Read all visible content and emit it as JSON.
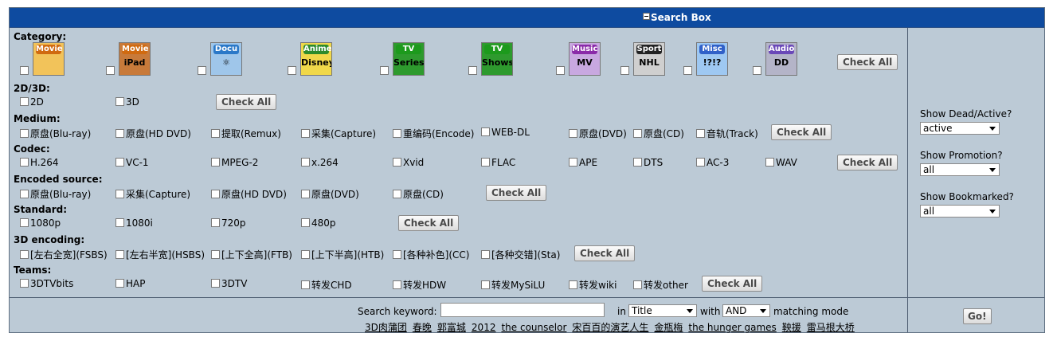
{
  "header": {
    "title": "Search Box"
  },
  "category": {
    "label": "Category:",
    "items": [
      {
        "name": "movie-bluray",
        "tag": "Movie",
        "sub": "",
        "color": "#d06a10",
        "bg": "#f2c35a"
      },
      {
        "name": "movie-ipad",
        "tag": "Movie",
        "sub": "iPad",
        "color": "#d06a10",
        "bg": "#c87a3a"
      },
      {
        "name": "docu",
        "tag": "Docu",
        "sub": "⚛",
        "color": "#2a78c8",
        "bg": "#9fc6ea"
      },
      {
        "name": "anime",
        "tag": "Anime",
        "sub": "Disney",
        "color": "#2c8a2c",
        "bg": "#f0d84a"
      },
      {
        "name": "tv-series",
        "tag": "TV",
        "sub": "Series",
        "color": "#1c9a1c",
        "bg": "#2e9a2e"
      },
      {
        "name": "tv-shows",
        "tag": "TV",
        "sub": "Shows",
        "color": "#1c9a1c",
        "bg": "#2e9a2e"
      },
      {
        "name": "music",
        "tag": "Music",
        "sub": "MV",
        "color": "#8a2aa8",
        "bg": "#c8a8e0"
      },
      {
        "name": "sport",
        "tag": "Sport",
        "sub": "NHL",
        "color": "#222222",
        "bg": "#cfcfcf"
      },
      {
        "name": "misc",
        "tag": "Misc",
        "sub": "!?!?",
        "color": "#3060c8",
        "bg": "#9ec8f2"
      },
      {
        "name": "audio",
        "tag": "Audio",
        "sub": "DD",
        "color": "#6a48b8",
        "bg": "#b4b4c8"
      }
    ],
    "check_all": "Check All"
  },
  "dim": {
    "label": "2D/3D:",
    "options": [
      "2D",
      "3D"
    ],
    "check_all": "Check All"
  },
  "medium": {
    "label": "Medium:",
    "options": [
      "原盘(Blu-ray)",
      "原盘(HD DVD)",
      "提取(Remux)",
      "采集(Capture)",
      "重编码(Encode)",
      "WEB-DL",
      "原盘(DVD)",
      "原盘(CD)",
      "音轨(Track)"
    ],
    "check_all": "Check All"
  },
  "codec": {
    "label": "Codec:",
    "options": [
      "H.264",
      "VC-1",
      "MPEG-2",
      "x.264",
      "Xvid",
      "FLAC",
      "APE",
      "DTS",
      "AC-3",
      "WAV"
    ],
    "check_all": "Check All"
  },
  "encoded": {
    "label": "Encoded source:",
    "options": [
      "原盘(Blu-ray)",
      "采集(Capture)",
      "原盘(HD DVD)",
      "原盘(DVD)",
      "原盘(CD)"
    ],
    "check_all": "Check All"
  },
  "standard": {
    "label": "Standard:",
    "options": [
      "1080p",
      "1080i",
      "720p",
      "480p"
    ],
    "check_all": "Check All"
  },
  "enc3d": {
    "label": "3D encoding:",
    "options": [
      "[左右全宽](FSBS)",
      "[左右半宽](HSBS)",
      "[上下全高](FTB)",
      "[上下半高](HTB)",
      "[各种补色](CC)",
      "[各种交错](Sta)"
    ],
    "check_all": "Check All"
  },
  "teams": {
    "label": "Teams:",
    "options": [
      "3DTVbits",
      "HAP",
      "3DTV",
      "转发CHD",
      "转发HDW",
      "转发MySiLU",
      "转发wiki",
      "转发other"
    ],
    "check_all": "Check All"
  },
  "right": {
    "dead_label": "Show Dead/Active?",
    "dead_value": "active",
    "promo_label": "Show Promotion?",
    "promo_value": "all",
    "bookmark_label": "Show Bookmarked?",
    "bookmark_value": "all"
  },
  "search": {
    "keyword_label": "Search keyword:",
    "keyword_value": "",
    "in_label": "in",
    "in_value": "Title",
    "with_label": "with",
    "with_value": "AND",
    "mode_label": "matching mode",
    "go": "Go!",
    "hot": [
      "3D肉蒲团",
      "春晚",
      "郭富城",
      "2012",
      "the counselor",
      "宋百百的演艺人生",
      "金瓶梅",
      "the hunger games",
      "鞅援",
      "雷马根大桥"
    ]
  },
  "colors": {
    "header_bg": "#0e4ba0",
    "panel_bg": "#bccad6"
  }
}
